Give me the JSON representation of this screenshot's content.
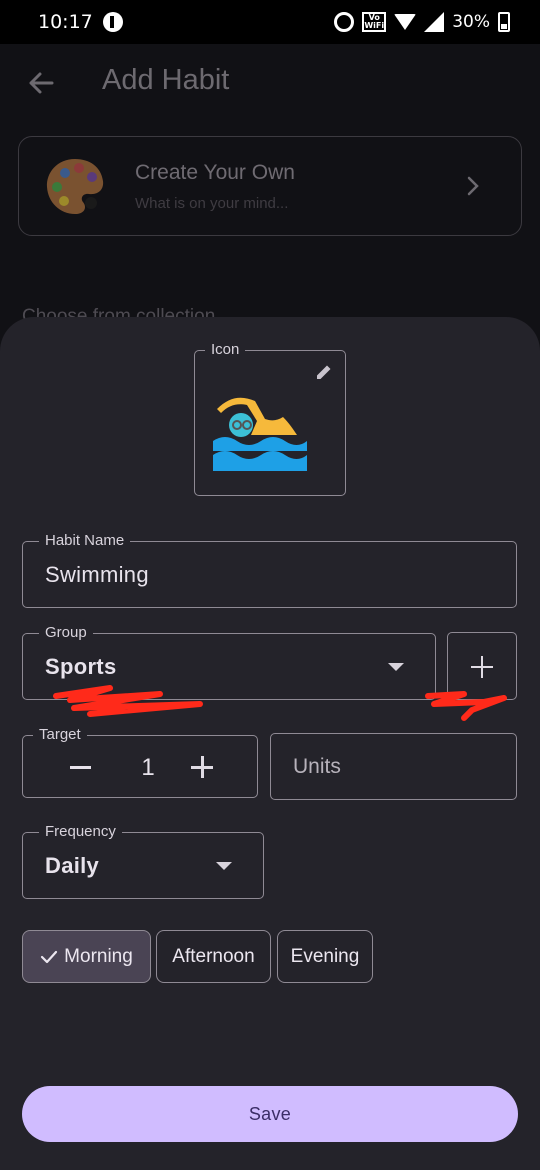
{
  "status_bar": {
    "time": "10:17",
    "battery": "30%",
    "volte_top": "Vo",
    "volte_bottom": "WiFi"
  },
  "app_bar": {
    "title": "Add Habit",
    "back_icon": "arrow-left-icon"
  },
  "create_card": {
    "title": "Create Your Own",
    "subtitle": "What is on your mind...",
    "icon": "palette-icon"
  },
  "collection_section": {
    "title": "Choose from collection"
  },
  "form": {
    "icon_label": "Icon",
    "icon": "swimmer-icon",
    "habit_name_label": "Habit Name",
    "habit_name_value": "Swimming",
    "group_label": "Group",
    "group_value": "Sports",
    "target_label": "Target",
    "target_value": "1",
    "units_placeholder": "Units",
    "frequency_label": "Frequency",
    "frequency_value": "Daily",
    "time_of_day": [
      {
        "label": "Morning",
        "selected": true
      },
      {
        "label": "Afternoon",
        "selected": false
      },
      {
        "label": "Evening",
        "selected": false
      }
    ],
    "save_label": "Save"
  },
  "colors": {
    "sheet_bg": "#24232a",
    "accent": "#d0bcff",
    "chip_selected": "#4a4454",
    "annotation_red": "#ff2a1a"
  }
}
